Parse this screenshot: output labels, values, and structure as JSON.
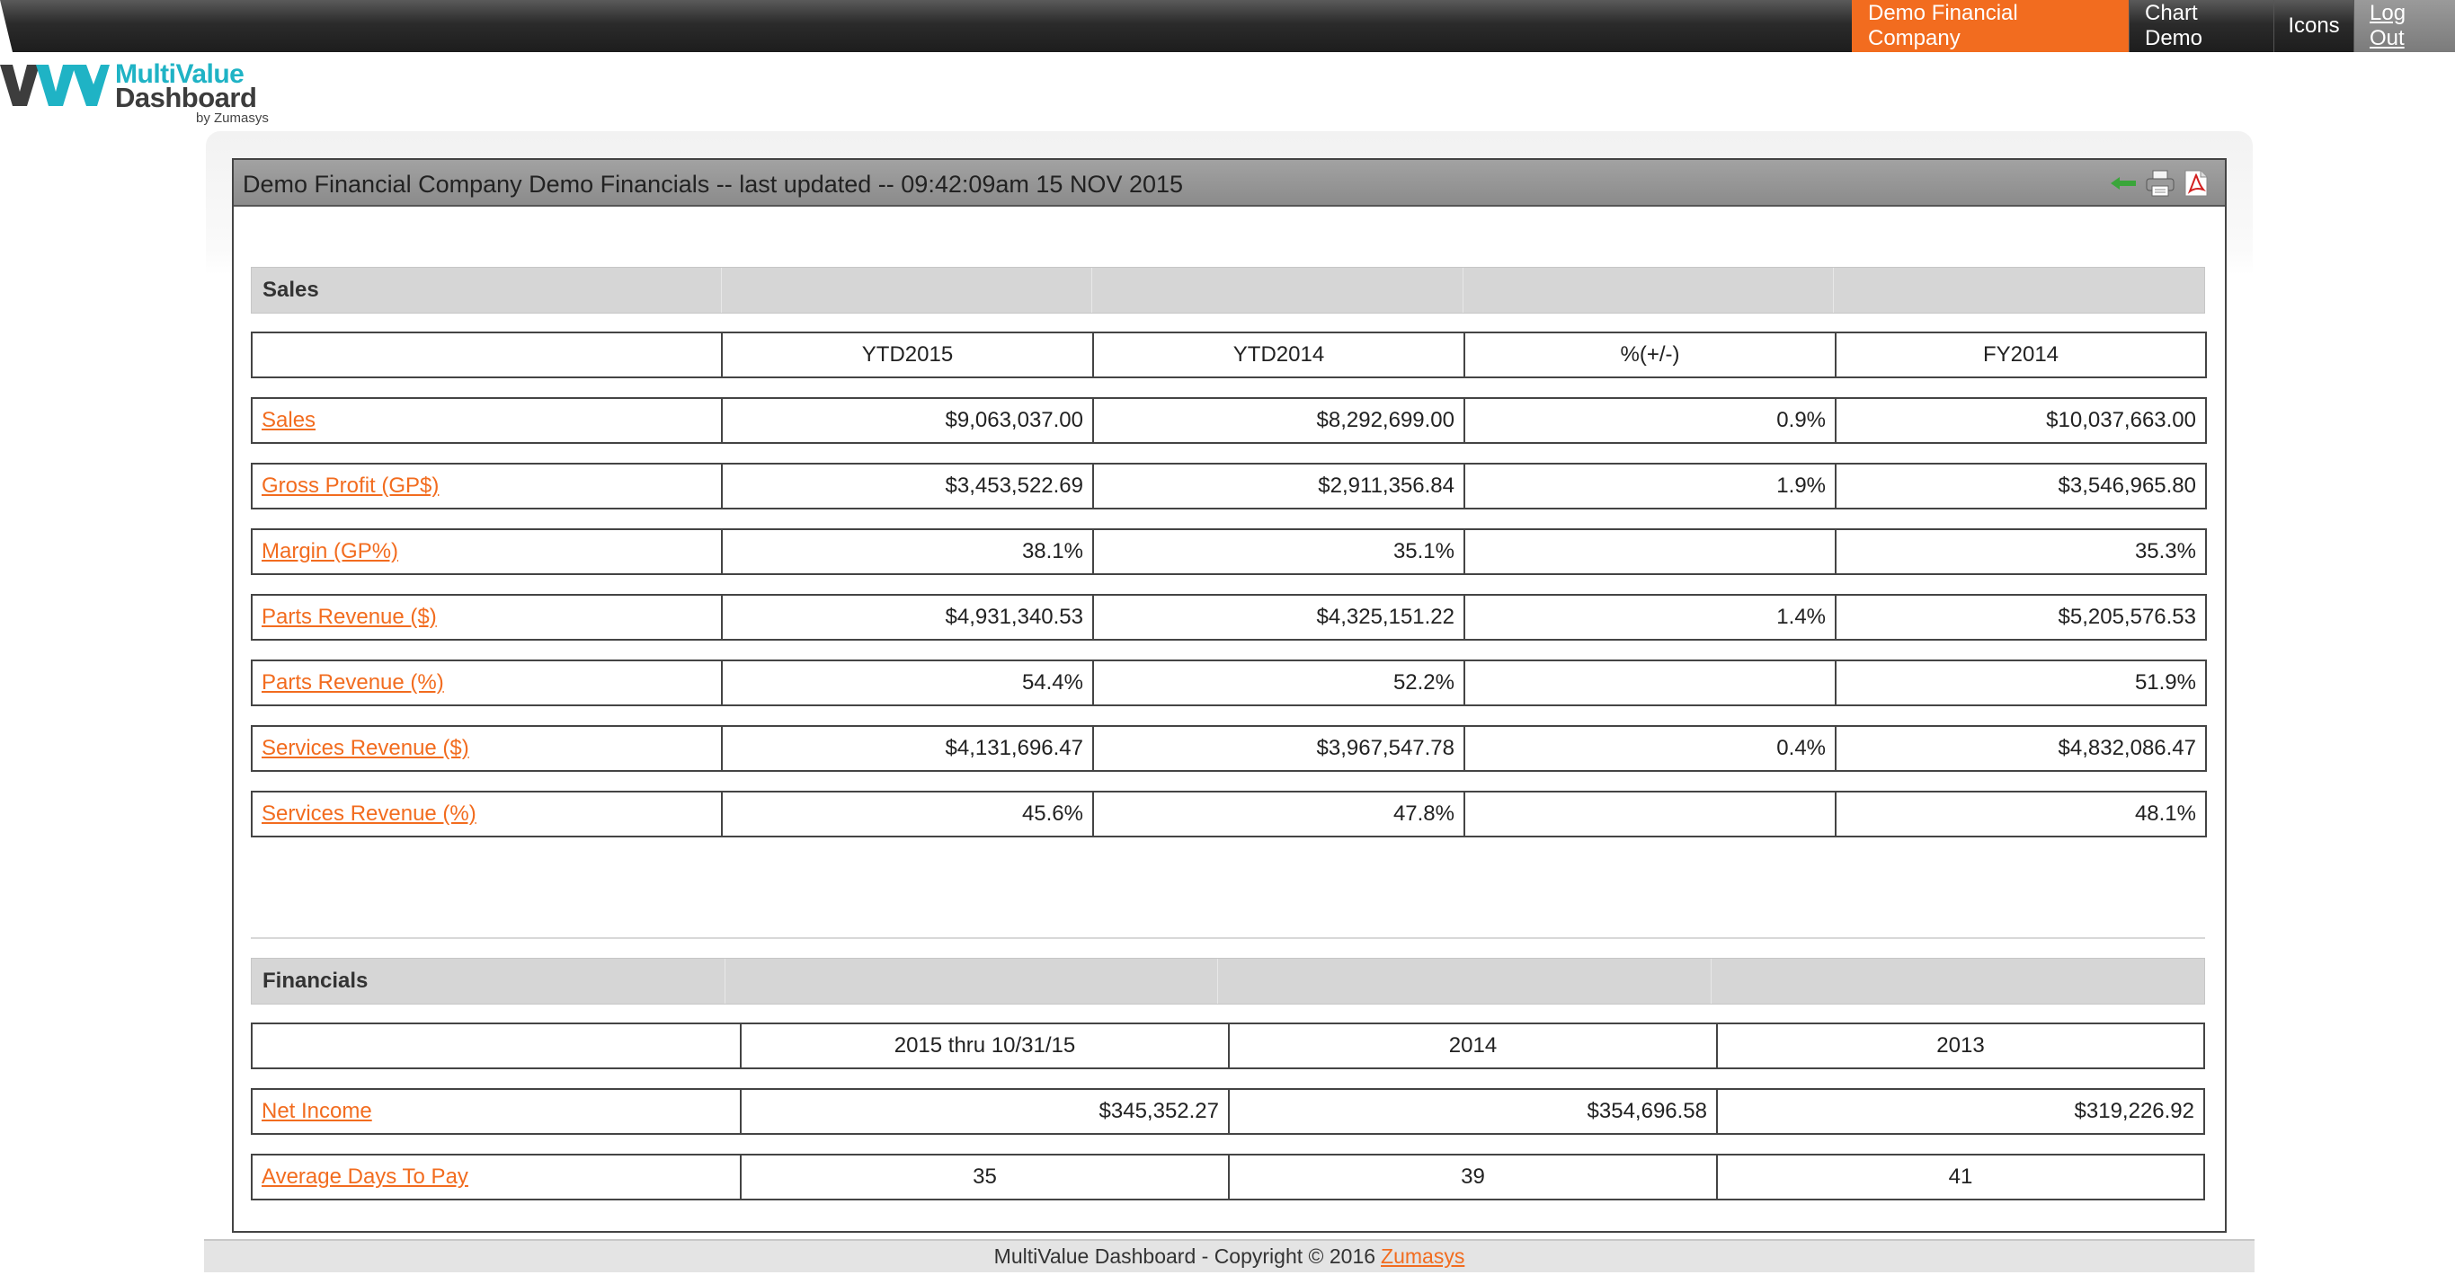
{
  "nav": {
    "items": [
      {
        "label": "Demo Financial Company",
        "active": true
      },
      {
        "label": "Chart Demo",
        "active": false
      },
      {
        "label": "Icons",
        "active": false
      },
      {
        "label": "Log Out",
        "active": false
      }
    ]
  },
  "logo": {
    "title": "MultiValue",
    "subtitle": "Dashboard",
    "byline": "by Zumasys"
  },
  "panel": {
    "title": "Demo Financial Company Demo Financials -- last updated -- 09:42:09am 15 NOV 2015",
    "icons": [
      "back-arrow-icon",
      "print-icon",
      "pdf-icon"
    ]
  },
  "sales": {
    "section_title": "Sales",
    "columns": [
      "",
      "YTD2015",
      "YTD2014",
      "%(+/-)",
      "FY2014"
    ],
    "rows": [
      {
        "label": "Sales",
        "ytd2015": "$9,063,037.00",
        "ytd2014": "$8,292,699.00",
        "pct": "0.9%",
        "fy2014": "$10,037,663.00"
      },
      {
        "label": "Gross Profit (GP$)",
        "ytd2015": "$3,453,522.69",
        "ytd2014": "$2,911,356.84",
        "pct": "1.9%",
        "fy2014": "$3,546,965.80"
      },
      {
        "label": "Margin (GP%)",
        "ytd2015": "38.1%",
        "ytd2014": "35.1%",
        "pct": "",
        "fy2014": "35.3%"
      },
      {
        "label": "Parts Revenue ($)",
        "ytd2015": "$4,931,340.53",
        "ytd2014": "$4,325,151.22",
        "pct": "1.4%",
        "fy2014": "$5,205,576.53"
      },
      {
        "label": "Parts Revenue (%)",
        "ytd2015": "54.4%",
        "ytd2014": "52.2%",
        "pct": "",
        "fy2014": "51.9%"
      },
      {
        "label": "Services Revenue ($)",
        "ytd2015": "$4,131,696.47",
        "ytd2014": "$3,967,547.78",
        "pct": "0.4%",
        "fy2014": "$4,832,086.47"
      },
      {
        "label": "Services Revenue (%)",
        "ytd2015": "45.6%",
        "ytd2014": "47.8%",
        "pct": "",
        "fy2014": "48.1%"
      }
    ]
  },
  "financials": {
    "section_title": "Financials",
    "columns": [
      "",
      "2015 thru 10/31/15",
      "2014",
      "2013"
    ],
    "rows": [
      {
        "label": "Net Income",
        "c2015": "$345,352.27",
        "c2014": "$354,696.58",
        "c2013": "$319,226.92"
      },
      {
        "label": "Average Days To Pay",
        "c2015": "35",
        "c2014": "39",
        "c2013": "41"
      }
    ]
  },
  "footer": {
    "text": "MultiValue Dashboard - Copyright © 2016",
    "link": "Zumasys"
  },
  "colors": {
    "accent": "#f26c1f",
    "logo_teal": "#1fb3c5",
    "header_gray": "#8b8b8b"
  }
}
